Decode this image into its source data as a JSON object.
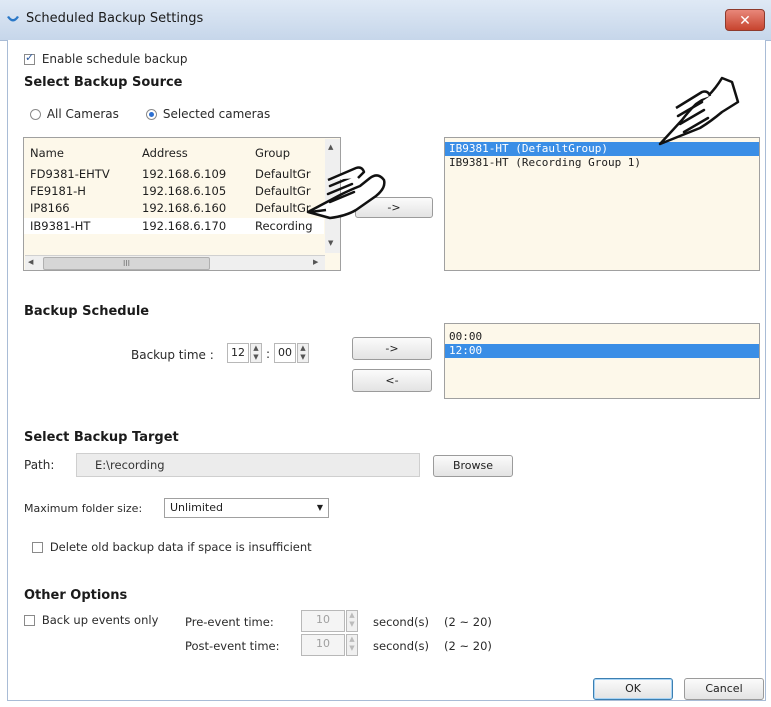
{
  "window": {
    "title": "Scheduled Backup Settings",
    "close_symbol": "✕"
  },
  "enable_schedule": {
    "label": "Enable schedule backup",
    "checked": true
  },
  "backup_source": {
    "title": "Select Backup Source",
    "radio_all": "All Cameras",
    "radio_selected": "Selected cameras",
    "selected_option": "Selected cameras",
    "table": {
      "headers": [
        "Name",
        "Address",
        "Group"
      ],
      "rows": [
        [
          "FD9381-EHTV",
          "192.168.6.109",
          "DefaultGr"
        ],
        [
          "FE9181-H",
          "192.168.6.105",
          "DefaultGr"
        ],
        [
          "IP8166",
          "192.168.6.160",
          "DefaultGr"
        ],
        [
          "IB9381-HT",
          "192.168.6.170",
          "Recording"
        ]
      ],
      "scroll_marker": "III"
    },
    "add_button": "->",
    "selected_list": [
      "IB9381-HT (DefaultGroup)",
      "IB9381-HT (Recording Group 1)"
    ],
    "selected_index": 0
  },
  "backup_schedule": {
    "title": "Backup Schedule",
    "time_label": "Backup time :",
    "hour": "12",
    "minute": "00",
    "separator": ":",
    "add_button": "->",
    "remove_button": "<-",
    "times": [
      "00:00",
      "12:00"
    ],
    "selected_index": 1
  },
  "backup_target": {
    "title": "Select Backup Target",
    "path_label": "Path:",
    "path_value": "E:\\recording",
    "browse_button": "Browse",
    "max_size_label": "Maximum folder size:",
    "max_size_value": "Unlimited",
    "delete_old_label": "Delete old backup data if space is insufficient",
    "delete_old_checked": false
  },
  "other_options": {
    "title": "Other Options",
    "events_only_label": "Back up events only",
    "events_only_checked": false,
    "pre_event_label": "Pre-event time:",
    "pre_event_value": "10",
    "post_event_label": "Post-event time:",
    "post_event_value": "10",
    "unit": "second(s)",
    "range": "(2 ~ 20)"
  },
  "footer": {
    "ok": "OK",
    "cancel": "Cancel"
  },
  "colors": {
    "selection": "#3a8ee6",
    "list_bg": "#fdf8ea",
    "title_bar": "#c6d6ea"
  }
}
